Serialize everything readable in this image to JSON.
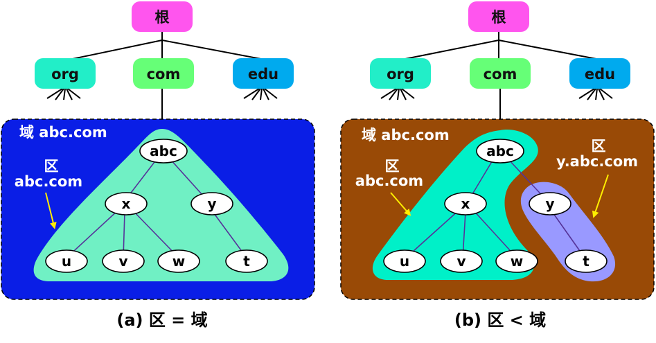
{
  "root_label": "根",
  "tld_labels": [
    "org",
    "com",
    "edu"
  ],
  "colors": {
    "root": "#ff55ee",
    "org": "#22eec8",
    "com": "#66ff77",
    "edu": "#00aaee",
    "panel_a": "#0a1ee6",
    "panel_b": "#994a06",
    "zone_a": "#70f0c4",
    "zone_b_main": "#00f0c8",
    "zone_b_y": "#9999ff",
    "arrow": "#ffee00",
    "edge": "#553399"
  },
  "panel_a": {
    "domain_label": "域 abc.com",
    "zone_label_line1": "区",
    "zone_label_line2": "abc.com",
    "caption": "(a) 区 = 域"
  },
  "panel_b": {
    "domain_label": "域 abc.com",
    "zone1_label_line1": "区",
    "zone1_label_line2": "abc.com",
    "zone2_label_line1": "区",
    "zone2_label_line2": "y.abc.com",
    "caption": "(b) 区 < 域"
  },
  "nodes": {
    "abc": "abc",
    "x": "x",
    "y": "y",
    "u": "u",
    "v": "v",
    "w": "w",
    "t": "t"
  }
}
